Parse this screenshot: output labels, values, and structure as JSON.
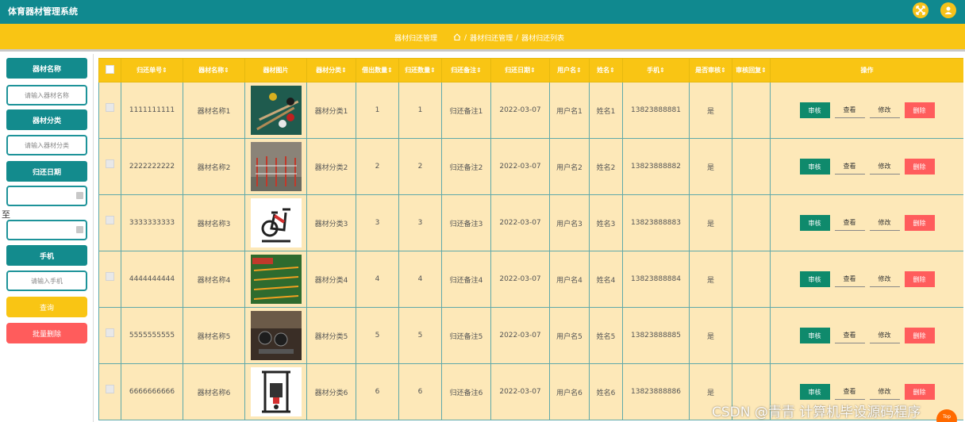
{
  "app": {
    "title": "体育器材管理系统"
  },
  "breadcrumb": {
    "section": "器材归还管理",
    "path1": "器材归还管理",
    "path2": "器材归还列表",
    "separator": "/"
  },
  "sidebar": {
    "name_label": "器材名称",
    "name_placeholder": "请输入器材名称",
    "category_label": "器材分类",
    "category_placeholder": "请输入器材分类",
    "date_label": "归还日期",
    "to_label": "至",
    "phone_label": "手机",
    "phone_placeholder": "请输入手机",
    "search_label": "查询",
    "bulk_delete_label": "批量删除"
  },
  "table": {
    "headers": [
      "归还单号",
      "器材名称",
      "器材图片",
      "器材分类",
      "借出数量",
      "归还数量",
      "归还备注",
      "归还日期",
      "用户名",
      "姓名",
      "手机",
      "是否审核",
      "审核回复",
      "操作"
    ],
    "sort_mark": "⇕",
    "actions": {
      "audit": "审核",
      "view": "查看",
      "edit": "修改",
      "delete": "删除"
    },
    "rows": [
      {
        "no": "1111111111",
        "name": "器材名称1",
        "category": "器材分类1",
        "lend_qty": "1",
        "return_qty": "1",
        "remark": "归还备注1",
        "date": "2022-03-07",
        "username": "用户名1",
        "realname": "姓名1",
        "phone": "13823888881",
        "audited": "是",
        "reply": ""
      },
      {
        "no": "2222222222",
        "name": "器材名称2",
        "category": "器材分类2",
        "lend_qty": "2",
        "return_qty": "2",
        "remark": "归还备注2",
        "date": "2022-03-07",
        "username": "用户名2",
        "realname": "姓名2",
        "phone": "13823888882",
        "audited": "是",
        "reply": ""
      },
      {
        "no": "3333333333",
        "name": "器材名称3",
        "category": "器材分类3",
        "lend_qty": "3",
        "return_qty": "3",
        "remark": "归还备注3",
        "date": "2022-03-07",
        "username": "用户名3",
        "realname": "姓名3",
        "phone": "13823888883",
        "audited": "是",
        "reply": ""
      },
      {
        "no": "4444444444",
        "name": "器材名称4",
        "category": "器材分类4",
        "lend_qty": "4",
        "return_qty": "4",
        "remark": "归还备注4",
        "date": "2022-03-07",
        "username": "用户名4",
        "realname": "姓名4",
        "phone": "13823888884",
        "audited": "是",
        "reply": ""
      },
      {
        "no": "5555555555",
        "name": "器材名称5",
        "category": "器材分类5",
        "lend_qty": "5",
        "return_qty": "5",
        "remark": "归还备注5",
        "date": "2022-03-07",
        "username": "用户名5",
        "realname": "姓名5",
        "phone": "13823888885",
        "audited": "是",
        "reply": ""
      },
      {
        "no": "6666666666",
        "name": "器材名称6",
        "category": "器材分类6",
        "lend_qty": "6",
        "return_qty": "6",
        "remark": "归还备注6",
        "date": "2022-03-07",
        "username": "用户名6",
        "realname": "姓名6",
        "phone": "13823888886",
        "audited": "是",
        "reply": ""
      }
    ]
  },
  "watermark": "CSDN @青青  计算机毕设源码程序",
  "top_button": "Top",
  "colors": {
    "topbar": "#10898f",
    "accent_yellow": "#f9c514",
    "teal": "#138b8d",
    "row_bg": "#fde8b8",
    "danger": "#ff5c5c",
    "audit_green": "#0f8a6c"
  },
  "icons": {
    "fullscreen": "fullscreen-icon",
    "user": "user-icon",
    "home": "home-icon",
    "calendar": "calendar-icon"
  }
}
